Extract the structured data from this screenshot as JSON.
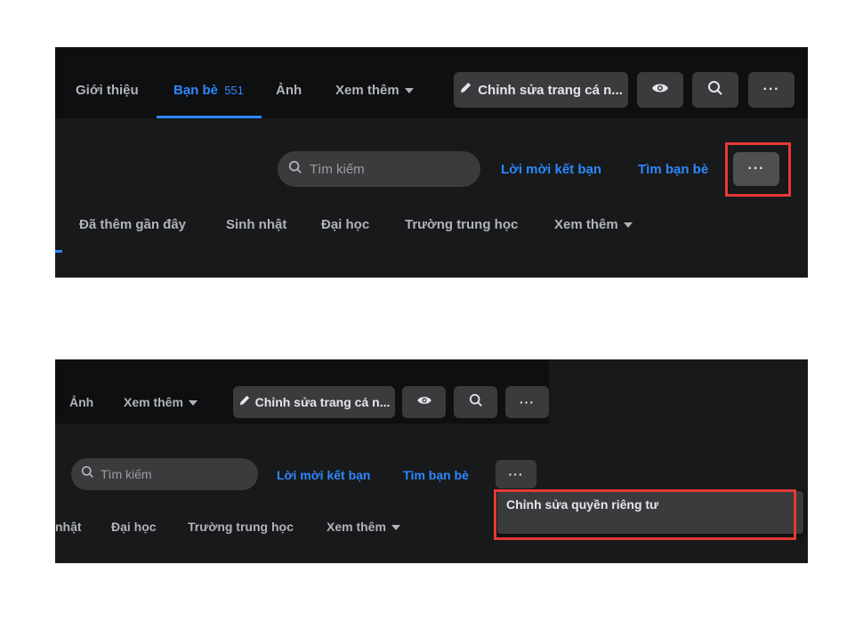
{
  "profile_nav": {
    "tab_about": "Giới thiệu",
    "tab_friends": "Bạn bè",
    "tab_friends_count": "551",
    "tab_photos": "Ảnh",
    "tab_more": "Xem thêm",
    "edit_profile_label": "Chỉnh sửa trang cá n...",
    "view_as_icon": "eye-icon",
    "search_icon": "search-icon",
    "more_icon": "more-horizontal-icon"
  },
  "friends_toolbar": {
    "search_placeholder": "Tìm kiếm",
    "friend_requests": "Lời mời kết bạn",
    "find_friends": "Tìm bạn bè"
  },
  "friend_filters": {
    "recently_added": "Đã thêm gần đây",
    "birthdays": "Sinh nhật",
    "birthdays_partial": "nhật",
    "university": "Đại học",
    "high_school": "Trường trung học",
    "more": "Xem thêm"
  },
  "dropdown": {
    "edit_privacy": "Chỉnh sửa quyền riêng tư"
  },
  "colors": {
    "accent": "#2d88ff",
    "highlight": "#e53935",
    "background": "#18191a",
    "button": "#3a3b3c"
  }
}
